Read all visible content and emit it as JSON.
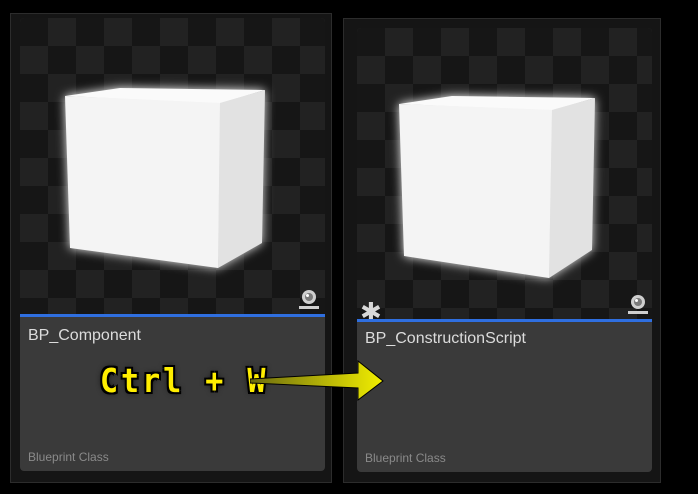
{
  "cards": [
    {
      "name": "BP_Component",
      "type": "Blueprint Class",
      "unsaved": false
    },
    {
      "name": "BP_ConstructionScript",
      "type": "Blueprint Class",
      "unsaved": true
    }
  ],
  "annotation": {
    "shortcut": "Ctrl + W"
  },
  "icons": {
    "thumbnail_badge": "camera-icon",
    "dirty_marker": "asterisk-icon",
    "arrow": "arrow-right-icon"
  },
  "colors": {
    "accent": "#2f6fe0",
    "annotation_text": "#ffee00",
    "card_background": "#3a3a3a",
    "page_background": "#000000"
  }
}
